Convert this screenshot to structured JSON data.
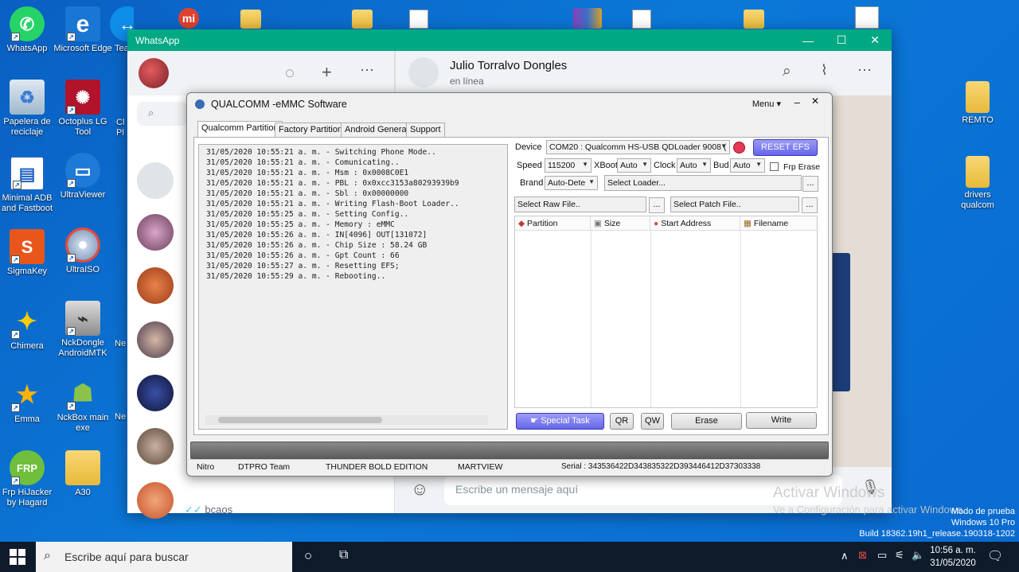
{
  "desktop": {
    "icons": [
      {
        "label": "WhatsApp"
      },
      {
        "label": "Microsoft Edge"
      },
      {
        "label": "Tea"
      },
      {
        "label": "Papelera de reciclaje"
      },
      {
        "label": "Octoplus LG Tool"
      },
      {
        "label": "Cl Pl"
      },
      {
        "label": "Minimal ADB and Fastboot"
      },
      {
        "label": "UltraViewer"
      },
      {
        "label": "SigmaKey"
      },
      {
        "label": "UltraISO"
      },
      {
        "label": "Chimera"
      },
      {
        "label": "NckDongle AndroidMTK"
      },
      {
        "label": "Ne"
      },
      {
        "label": "Emma"
      },
      {
        "label": "NckBox main exe"
      },
      {
        "label": "Ne"
      },
      {
        "label": "Frp HiJacker by Hagard"
      },
      {
        "label": "A30"
      },
      {
        "label": "REMTO"
      },
      {
        "label": "drivers qualcom"
      }
    ],
    "watermark": {
      "line1": "Activar Windows",
      "line2": "Ve a Configuración para activar Windows.",
      "build1": "Modo de prueba",
      "build2": "Windows 10 Pro",
      "build3": "Build 18362.19h1_release.190318-1202"
    }
  },
  "whatsapp": {
    "title": "WhatsApp",
    "contact_name": "Julio Torralvo Dongles",
    "contact_status": "en línea",
    "last_chat_preview": "bcaos",
    "message_placeholder": "Escribe un mensaje aquí"
  },
  "qualcomm": {
    "title": "QUALCOMM -eMMC Software",
    "menu_label": "Menu",
    "tabs": [
      "Qualcomm Partition",
      "Factory Partition",
      "Android General",
      "Support"
    ],
    "log": [
      "31/05/2020 10:55:21 a. m. - Switching Phone Mode..",
      "31/05/2020 10:55:21 a. m. - Comunicating..",
      "31/05/2020 10:55:21 a. m. - Msm : 0x0008C0E1",
      "31/05/2020 10:55:21 a. m. - PBL : 0x0xcc3153a80293939b9",
      "31/05/2020 10:55:21 a. m. - Sbl : 0x00000000",
      "31/05/2020 10:55:21 a. m. - Writing Flash-Boot Loader..",
      "31/05/2020 10:55:25 a. m. - Setting Config..",
      "31/05/2020 10:55:25 a. m. - Memory : eMMC",
      "31/05/2020 10:55:26 a. m. - IN[4096] OUT[131072]",
      "31/05/2020 10:55:26 a. m. - Chip Size : 58.24 GB",
      "31/05/2020 10:55:26 a. m. - Gpt Count : 66",
      "31/05/2020 10:55:27 a. m. - Resetting EFS;",
      "31/05/2020 10:55:29 a. m. - Rebooting.."
    ],
    "device_label": "Device",
    "device_value": "COM20 : Qualcomm HS-USB QDLoader 9008 (",
    "reset_efs": "RESET EFS",
    "speed_label": "Speed",
    "speed_value": "115200",
    "xboot_label": "XBoot",
    "xboot_value": "Auto",
    "clock_label": "Clock",
    "clock_value": "Auto",
    "bud_label": "Bud",
    "bud_value": "Auto",
    "frp_erase_label": "Frp Erase",
    "brand_label": "Brand",
    "brand_value": "Auto-Dete",
    "loader_placeholder": "Select Loader...",
    "raw_file": "Select Raw File..",
    "patch_file": "Select Patch File..",
    "dots": "...",
    "columns": [
      "Partition",
      "Size",
      "Start Address",
      "Filename"
    ],
    "special_task": "Special Task",
    "qr": "QR",
    "qw": "QW",
    "erase": "Erase",
    "write": "Write",
    "status": [
      "Nitro",
      "DTPRO Team",
      "THUNDER BOLD EDITION",
      "MARTVIEW",
      "Serial : 343536422D343835322D393446412D37303338"
    ]
  },
  "taskbar": {
    "search_placeholder": "Escribe aquí para buscar",
    "time": "10:56 a. m.",
    "date": "31/05/2020"
  },
  "colors": {
    "desktop": "#0b6fd2",
    "whatsapp_green": "#00a884",
    "reset_efs": "#6666e8",
    "taskbar": "#0d1b2b"
  }
}
